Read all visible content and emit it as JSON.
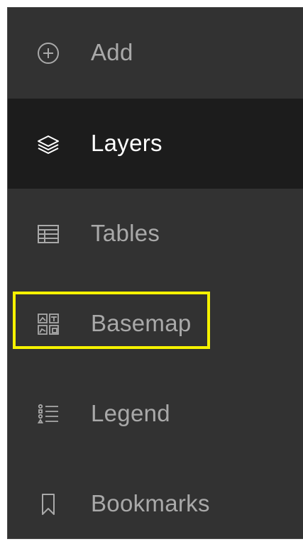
{
  "sidebar": {
    "items": [
      {
        "label": "Add",
        "icon": "plus-circle-icon",
        "active": false
      },
      {
        "label": "Layers",
        "icon": "layers-icon",
        "active": true
      },
      {
        "label": "Tables",
        "icon": "table-icon",
        "active": false
      },
      {
        "label": "Basemap",
        "icon": "basemap-icon",
        "active": false,
        "highlighted": true
      },
      {
        "label": "Legend",
        "icon": "legend-icon",
        "active": false
      },
      {
        "label": "Bookmarks",
        "icon": "bookmark-icon",
        "active": false
      }
    ]
  },
  "colors": {
    "panel_bg": "#323232",
    "active_bg": "#1c1c1c",
    "label_inactive": "#a9a9a9",
    "label_active": "#ffffff",
    "highlight": "#f6f200"
  }
}
